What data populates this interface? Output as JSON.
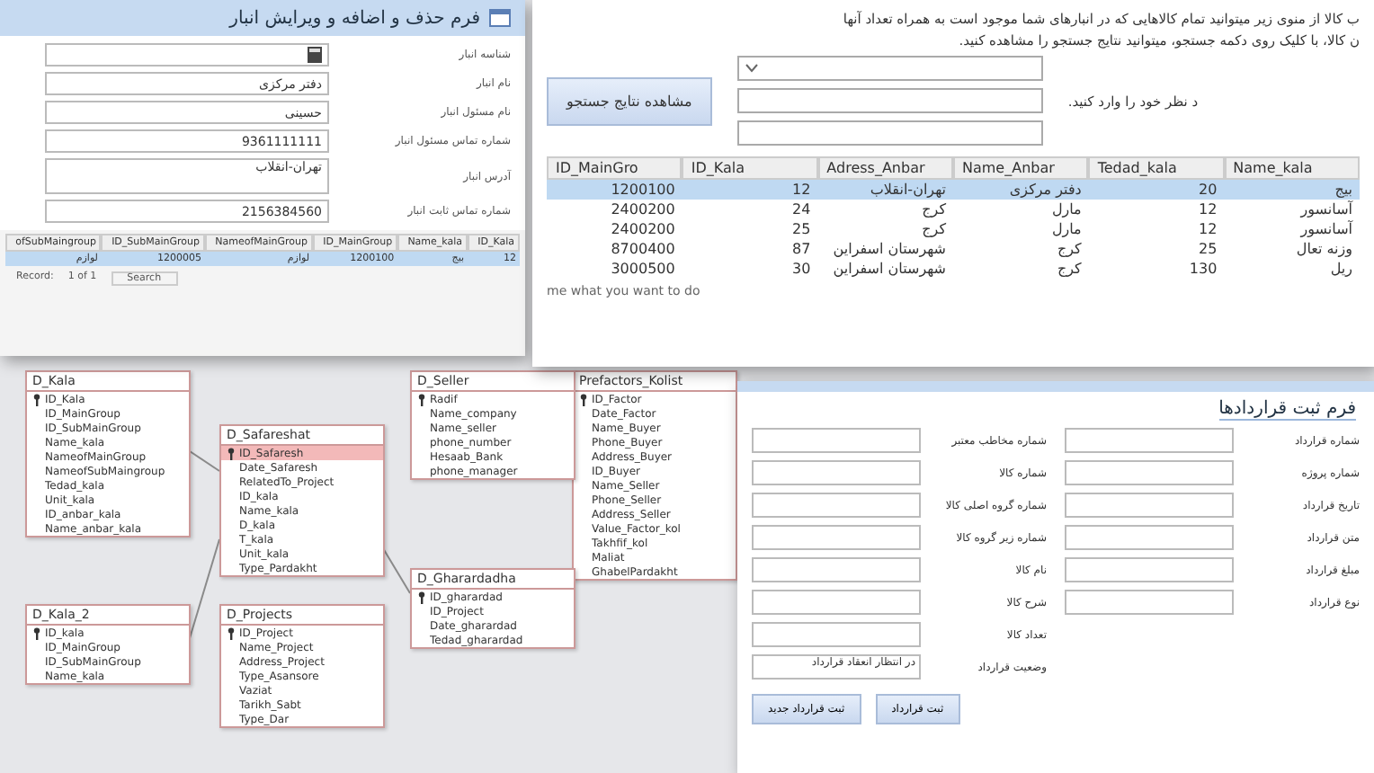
{
  "diagram": {
    "tables": [
      {
        "name": "Prefactors_Kolist",
        "fields": [
          {
            "name": "ID_Factor",
            "key": true,
            "selected": false
          },
          {
            "name": "Date_Factor",
            "key": false,
            "selected": false
          },
          {
            "name": "Name_Buyer",
            "key": false,
            "selected": false
          },
          {
            "name": "Phone_Buyer",
            "key": false,
            "selected": false
          },
          {
            "name": "Address_Buyer",
            "key": false,
            "selected": false
          },
          {
            "name": "ID_Buyer",
            "key": false,
            "selected": false
          },
          {
            "name": "Name_Seller",
            "key": false,
            "selected": false
          },
          {
            "name": "Phone_Seller",
            "key": false,
            "selected": false
          },
          {
            "name": "Address_Seller",
            "key": false,
            "selected": false
          },
          {
            "name": "Value_Factor_kol",
            "key": false,
            "selected": false
          },
          {
            "name": "Takhfif_kol",
            "key": false,
            "selected": false
          },
          {
            "name": "Maliat",
            "key": false,
            "selected": false
          },
          {
            "name": "GhabelPardakht",
            "key": false,
            "selected": false
          }
        ]
      },
      {
        "name": "D_Seller",
        "fields": [
          {
            "name": "Radif",
            "key": true,
            "selected": false
          },
          {
            "name": "Name_company",
            "key": false,
            "selected": false
          },
          {
            "name": "Name_seller",
            "key": false,
            "selected": false
          },
          {
            "name": "phone_number",
            "key": false,
            "selected": false
          },
          {
            "name": "Hesaab_Bank",
            "key": false,
            "selected": false
          },
          {
            "name": "phone_manager",
            "key": false,
            "selected": false
          }
        ]
      },
      {
        "name": "D_Kala",
        "fields": [
          {
            "name": "ID_Kala",
            "key": true,
            "selected": false
          },
          {
            "name": "ID_MainGroup",
            "key": false,
            "selected": false
          },
          {
            "name": "ID_SubMainGroup",
            "key": false,
            "selected": false
          },
          {
            "name": "Name_kala",
            "key": false,
            "selected": false
          },
          {
            "name": "NameofMainGroup",
            "key": false,
            "selected": false
          },
          {
            "name": "NameofSubMaingroup",
            "key": false,
            "selected": false
          },
          {
            "name": "Tedad_kala",
            "key": false,
            "selected": false
          },
          {
            "name": "Unit_kala",
            "key": false,
            "selected": false
          },
          {
            "name": "ID_anbar_kala",
            "key": false,
            "selected": false
          },
          {
            "name": "Name_anbar_kala",
            "key": false,
            "selected": false
          }
        ]
      },
      {
        "name": "D_Safareshat",
        "fields": [
          {
            "name": "ID_Safaresh",
            "key": true,
            "selected": true
          },
          {
            "name": "Date_Safaresh",
            "key": false,
            "selected": false
          },
          {
            "name": "RelatedTo_Project",
            "key": false,
            "selected": false
          },
          {
            "name": "ID_kala",
            "key": false,
            "selected": false
          },
          {
            "name": "Name_kala",
            "key": false,
            "selected": false
          },
          {
            "name": "D_kala",
            "key": false,
            "selected": false
          },
          {
            "name": "T_kala",
            "key": false,
            "selected": false
          },
          {
            "name": "Unit_kala",
            "key": false,
            "selected": false
          },
          {
            "name": "Type_Pardakht",
            "key": false,
            "selected": false
          }
        ]
      },
      {
        "name": "D_Gharardadha",
        "fields": [
          {
            "name": "ID_gharardad",
            "key": true,
            "selected": false
          },
          {
            "name": "ID_Project",
            "key": false,
            "selected": false
          },
          {
            "name": "Date_gharardad",
            "key": false,
            "selected": false
          },
          {
            "name": "Tedad_gharardad",
            "key": false,
            "selected": false
          }
        ]
      },
      {
        "name": "D_Projects",
        "fields": [
          {
            "name": "ID_Project",
            "key": true,
            "selected": false
          },
          {
            "name": "Name_Project",
            "key": false,
            "selected": false
          },
          {
            "name": "Address_Project",
            "key": false,
            "selected": false
          },
          {
            "name": "Type_Asansore",
            "key": false,
            "selected": false
          },
          {
            "name": "Vaziat",
            "key": false,
            "selected": false
          },
          {
            "name": "Tarikh_Sabt",
            "key": false,
            "selected": false
          },
          {
            "name": "Type_Dar",
            "key": false,
            "selected": false
          }
        ]
      },
      {
        "name": "D_Kala_2",
        "fields": [
          {
            "name": "ID_kala",
            "key": true,
            "selected": false
          },
          {
            "name": "ID_MainGroup",
            "key": false,
            "selected": false
          },
          {
            "name": "ID_SubMainGroup",
            "key": false,
            "selected": false
          },
          {
            "name": "Name_kala",
            "key": false,
            "selected": false
          }
        ]
      }
    ]
  },
  "search_form": {
    "instructions": [
      "ب کالا از منوی زیر میتوانید تمام کالاهایی که در انبارهای شما موجود است به همراه تعداد آنها",
      "ن کالا، با کلیک روی دکمه جستجو، میتوانید نتایج جستجو را مشاهده کنید."
    ],
    "field_hint": "د نظر خود را وارد کنید.",
    "button": "مشاهده نتایج جستجو",
    "tell_me": "me what you want to do",
    "table": {
      "columns": [
        "Name_kala",
        "Tedad_kala",
        "Name_Anbar",
        "Adress_Anbar",
        "ID_Kala",
        "ID_MainGro"
      ],
      "rows": [
        {
          "cells": [
            "بیج",
            "20",
            "دفتر مرکزی",
            "تهران-انقلاب",
            "12",
            "1200100"
          ],
          "selected": true
        },
        {
          "cells": [
            "آسانسور",
            "12",
            "مارل",
            "کرج",
            "24",
            "2400200"
          ],
          "selected": false
        },
        {
          "cells": [
            "آسانسور",
            "12",
            "مارل",
            "کرج",
            "25",
            "2400200"
          ],
          "selected": false
        },
        {
          "cells": [
            "وزنه تعال",
            "25",
            "کرج",
            "شهرستان اسفراین",
            "87",
            "8700400"
          ],
          "selected": false
        },
        {
          "cells": [
            "ریل",
            "130",
            "کرج",
            "شهرستان اسفراین",
            "30",
            "3000500"
          ],
          "selected": false
        }
      ]
    }
  },
  "warehouse_form": {
    "title": "فرم حذف و اضافه و ویرایش انبار",
    "fields": [
      {
        "label": "شناسه انبار",
        "kind": "icon"
      },
      {
        "label": "نام انبار",
        "kind": "text",
        "value": "دفتر مرکزی"
      },
      {
        "label": "نام مسئول انبار",
        "kind": "text",
        "value": "حسینی"
      },
      {
        "label": "شماره تماس مسئول انبار",
        "kind": "text",
        "value": "9361111111"
      },
      {
        "label": "آدرس انبار",
        "kind": "area",
        "value": "تهران-انقلاب"
      },
      {
        "label": "شماره تماس ثابت انبار",
        "kind": "text",
        "value": "2156384560"
      }
    ],
    "datasheet": {
      "columns": [
        "ID_Kala",
        "Name_kala",
        "ID_MainGroup",
        "NameofMainGroup",
        "ID_SubMainGroup",
        "ofSubMaingroup"
      ],
      "rows": [
        {
          "cells": [
            "12",
            "بیج",
            "1200100",
            "لوازم",
            "1200005",
            "لوازم"
          ],
          "selected": true
        }
      ]
    },
    "record_nav": {
      "label": "Record:",
      "position": "1 of 1",
      "search": "Search"
    }
  },
  "contract_form": {
    "title": "فرم ثبت قراردادها",
    "right_fields": [
      "شماره قرارداد",
      "شماره پروژه",
      "تاریخ قرارداد",
      "متن قرارداد",
      "مبلغ قرارداد",
      "نوع قرارداد"
    ],
    "left_fields": [
      {
        "label": "شماره مخاطب معتبر"
      },
      {
        "label": "شماره کالا"
      },
      {
        "label": "شماره گروه اصلی کالا"
      },
      {
        "label": "شماره زیر گروه کالا"
      },
      {
        "label": "نام کالا"
      },
      {
        "label": "شرح کالا"
      },
      {
        "label": "تعداد کالا"
      },
      {
        "label": "وضعیت قرارداد",
        "value": "در انتظار انعقاد قرارداد"
      }
    ],
    "buttons": [
      "ثبت قرارداد",
      "ثبت قرارداد جدید"
    ]
  }
}
